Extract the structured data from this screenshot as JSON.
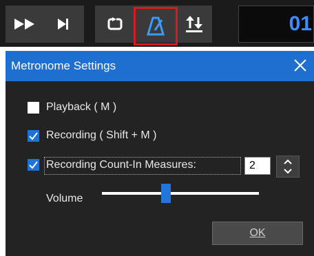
{
  "toolbar": {
    "buttons": [
      {
        "name": "fast-forward",
        "icon": "fast-forward-icon"
      },
      {
        "name": "skip-to-end",
        "icon": "skip-to-end-icon"
      },
      {
        "name": "loop",
        "icon": "loop-icon"
      },
      {
        "name": "metronome",
        "icon": "metronome-icon",
        "selected": true
      },
      {
        "name": "punch",
        "icon": "punch-arrows-icon"
      }
    ],
    "counter_text": "01"
  },
  "dialog": {
    "title": "Metronome Settings",
    "close_icon": "close-icon",
    "options": {
      "playback": {
        "label": "Playback ( M )",
        "checked": false
      },
      "recording": {
        "label": "Recording ( Shift + M )",
        "checked": true
      },
      "count_in": {
        "label": "Recording Count-In Measures:",
        "checked": true,
        "value": "2"
      }
    },
    "volume": {
      "label": "Volume",
      "level": 0.41
    },
    "ok_label": "OK"
  },
  "colors": {
    "accent_blue": "#1e6fd0",
    "selection_border": "#d51a22",
    "dialog_bg": "#232323",
    "counter_text": "#3c8dff"
  }
}
